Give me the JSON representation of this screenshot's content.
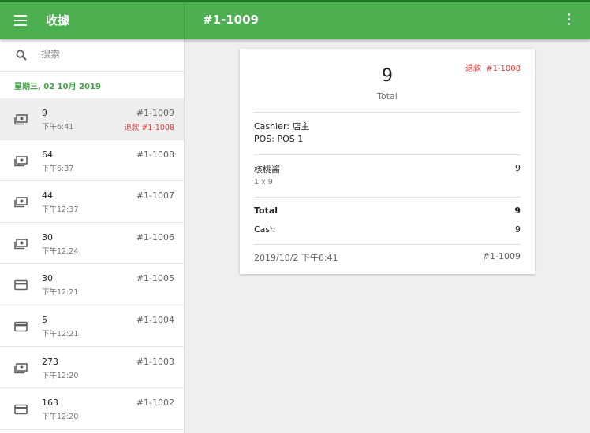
{
  "app": {
    "title": "收據",
    "receipt_title": "#1-1009"
  },
  "search": {
    "placeholder": "搜索"
  },
  "date_header": "星期三, 02 10月 2019",
  "receipts": [
    {
      "amount": "9",
      "time": "下午6:41",
      "number": "#1-1009",
      "refund": "退款 #1-1008",
      "icon": "cash-icon",
      "selected": true
    },
    {
      "amount": "64",
      "time": "下午6:37",
      "number": "#1-1008",
      "refund": "",
      "icon": "cash-icon"
    },
    {
      "amount": "44",
      "time": "下午12:37",
      "number": "#1-1007",
      "refund": "",
      "icon": "cash-icon"
    },
    {
      "amount": "30",
      "time": "下午12:24",
      "number": "#1-1006",
      "refund": "",
      "icon": "cash-icon"
    },
    {
      "amount": "30",
      "time": "下午12:21",
      "number": "#1-1005",
      "refund": "",
      "icon": "card-icon"
    },
    {
      "amount": "5",
      "time": "下午12:21",
      "number": "#1-1004",
      "refund": "",
      "icon": "card-icon"
    },
    {
      "amount": "273",
      "time": "下午12:20",
      "number": "#1-1003",
      "refund": "",
      "icon": "cash-icon"
    },
    {
      "amount": "163",
      "time": "下午12:20",
      "number": "#1-1002",
      "refund": "",
      "icon": "card-icon"
    }
  ],
  "detail": {
    "refund_label": "退款",
    "refund_ref": "#1-1008",
    "total_amount": "9",
    "total_label": "Total",
    "cashier": "Cashier: 店主",
    "pos": "POS: POS 1",
    "item_name": "核桃酱",
    "item_qty": "1 x 9",
    "item_price": "9",
    "total_row_label": "Total",
    "total_row_value": "9",
    "payment_label": "Cash",
    "payment_value": "9",
    "datetime": "2019/10/2 下午6:41",
    "receipt_number": "#1-1009"
  },
  "colors": {
    "primary": "#4caf50",
    "accent_green": "#43a047",
    "refund_red": "#e53935"
  }
}
